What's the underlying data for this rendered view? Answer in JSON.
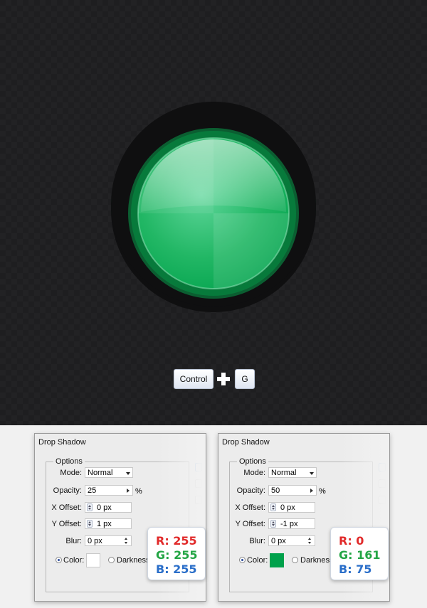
{
  "keys": {
    "control": "Control",
    "g": "G"
  },
  "dialogs": [
    {
      "title": "Drop Shadow",
      "options_legend": "Options",
      "mode_label": "Mode:",
      "mode_value": "Normal",
      "opacity_label": "Opacity:",
      "opacity_value": "25",
      "opacity_unit": "%",
      "x_offset_label": "X Offset:",
      "x_offset_value": "0 px",
      "y_offset_label": "Y Offset:",
      "y_offset_value": "1 px",
      "blur_label": "Blur:",
      "blur_value": "0 px",
      "color_label": "Color:",
      "darkness_label": "Darkness:",
      "swatch_color": "#ffffff",
      "rgb": {
        "r": "R: 255",
        "g": "G: 255",
        "b": "B: 255"
      }
    },
    {
      "title": "Drop Shadow",
      "options_legend": "Options",
      "mode_label": "Mode:",
      "mode_value": "Normal",
      "opacity_label": "Opacity:",
      "opacity_value": "50",
      "opacity_unit": "%",
      "x_offset_label": "X Offset:",
      "x_offset_value": "0 px",
      "y_offset_label": "Y Offset:",
      "y_offset_value": "-1 px",
      "blur_label": "Blur:",
      "blur_value": "0 px",
      "color_label": "Color:",
      "darkness_label": "Darkness:",
      "swatch_color": "#00a14b",
      "rgb": {
        "r": "R: 0",
        "g": "G: 161",
        "b": "B: 75"
      }
    }
  ],
  "colors": {
    "background": "#1e1e20",
    "button_green": "#00a14b",
    "ring_dark_green": "#0f6a38",
    "rgb_red": "#e12a2a",
    "rgb_green": "#23a544",
    "rgb_blue": "#2a6ec9"
  }
}
